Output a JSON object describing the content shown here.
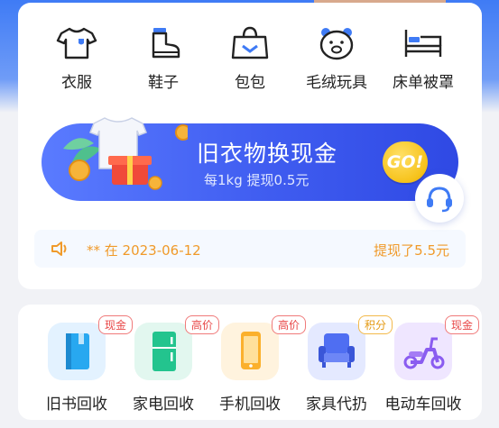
{
  "categories": [
    {
      "label": "衣服",
      "icon": "tshirt-icon"
    },
    {
      "label": "鞋子",
      "icon": "boot-icon"
    },
    {
      "label": "包包",
      "icon": "handbag-icon"
    },
    {
      "label": "毛绒玩具",
      "icon": "teddy-bear-icon"
    },
    {
      "label": "床单被罩",
      "icon": "bed-icon"
    }
  ],
  "banner": {
    "title": "旧衣物换现金",
    "subtitle": "每1kg  提现0.5元",
    "go_label": "GO!"
  },
  "notice": {
    "message": "** 在 2023-06-12",
    "amount": "提现了5.5元"
  },
  "services": [
    {
      "label": "旧书回收",
      "badge": "现金",
      "icon": "book-icon"
    },
    {
      "label": "家电回收",
      "badge": "高价",
      "icon": "fridge-icon"
    },
    {
      "label": "手机回收",
      "badge": "高价",
      "icon": "phone-icon"
    },
    {
      "label": "家具代扔",
      "badge": "积分",
      "icon": "sofa-icon"
    },
    {
      "label": "电动车回收",
      "badge": "现金",
      "icon": "scooter-icon"
    }
  ],
  "colors": {
    "primary": "#3f5cf0",
    "accent_orange": "#f09a2a",
    "badge_red": "#e84747",
    "badge_yellow": "#e49a14"
  }
}
